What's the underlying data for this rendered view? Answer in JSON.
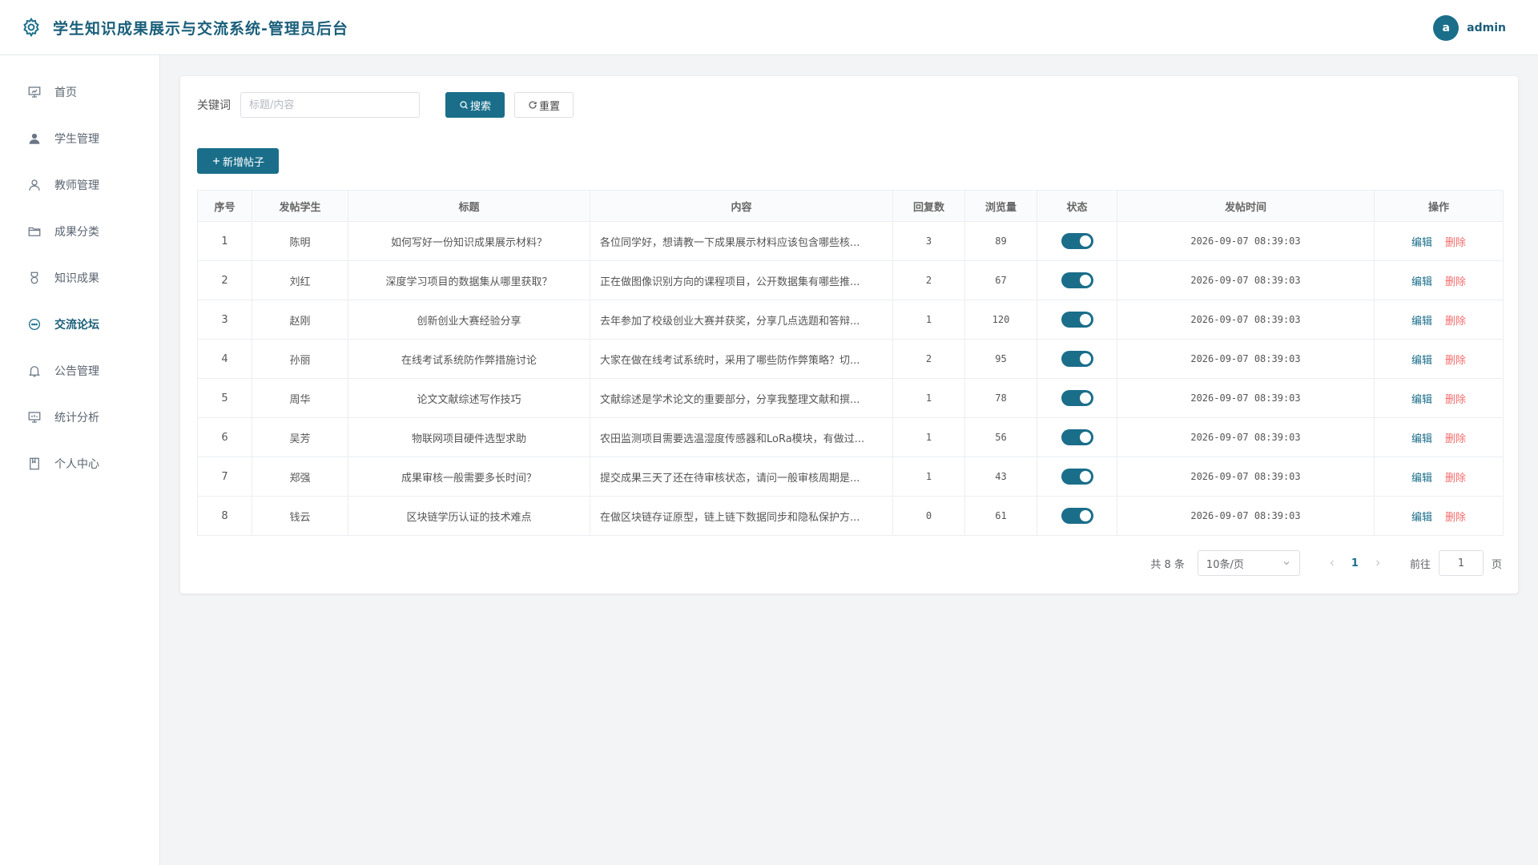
{
  "header": {
    "app_title": "学生知识成果展示与交流系统-管理员后台",
    "avatar_letter": "a",
    "username": "admin",
    "accent_color": "#1a6e8a"
  },
  "sidebar": {
    "items": [
      {
        "label": "首页",
        "icon": "presentation-icon"
      },
      {
        "label": "学生管理",
        "icon": "user-filled-icon"
      },
      {
        "label": "教师管理",
        "icon": "user-outline-icon"
      },
      {
        "label": "成果分类",
        "icon": "folder-icon"
      },
      {
        "label": "知识成果",
        "icon": "medal-icon"
      },
      {
        "label": "交流论坛",
        "icon": "chat-icon"
      },
      {
        "label": "公告管理",
        "icon": "bell-icon"
      },
      {
        "label": "统计分析",
        "icon": "chart-board-icon"
      },
      {
        "label": "个人中心",
        "icon": "notebook-icon"
      }
    ],
    "active": "交流论坛"
  },
  "search": {
    "label": "关键词",
    "placeholder": "标题/内容",
    "search_button": "搜索",
    "reset_button": "重置"
  },
  "toolbar": {
    "add_button": "新增帖子"
  },
  "table": {
    "columns": [
      "序号",
      "发帖学生",
      "标题",
      "内容",
      "回复数",
      "浏览量",
      "状态",
      "发帖时间",
      "操作"
    ],
    "edit_label": "编辑",
    "delete_label": "删除",
    "rows": [
      {
        "no": "1",
        "student": "陈明",
        "title": "如何写好一份知识成果展示材料？",
        "content": "各位同学好，想请教一下成果展示材料应该包含哪些核...",
        "replies": "3",
        "views": "89",
        "status_on": true,
        "time": "2026-09-07 08:39:03"
      },
      {
        "no": "2",
        "student": "刘红",
        "title": "深度学习项目的数据集从哪里获取？",
        "content": "正在做图像识别方向的课程项目，公开数据集有哪些推...",
        "replies": "2",
        "views": "67",
        "status_on": true,
        "time": "2026-09-07 08:39:03"
      },
      {
        "no": "3",
        "student": "赵刚",
        "title": "创新创业大赛经验分享",
        "content": "去年参加了校级创业大赛并获奖，分享几点选题和答辩...",
        "replies": "1",
        "views": "120",
        "status_on": true,
        "time": "2026-09-07 08:39:03"
      },
      {
        "no": "4",
        "student": "孙丽",
        "title": "在线考试系统防作弊措施讨论",
        "content": "大家在做在线考试系统时，采用了哪些防作弊策略？切...",
        "replies": "2",
        "views": "95",
        "status_on": true,
        "time": "2026-09-07 08:39:03"
      },
      {
        "no": "5",
        "student": "周华",
        "title": "论文文献综述写作技巧",
        "content": "文献综述是学术论文的重要部分，分享我整理文献和撰...",
        "replies": "1",
        "views": "78",
        "status_on": true,
        "time": "2026-09-07 08:39:03"
      },
      {
        "no": "6",
        "student": "吴芳",
        "title": "物联网项目硬件选型求助",
        "content": "农田监测项目需要选温湿度传感器和LoRa模块，有做过...",
        "replies": "1",
        "views": "56",
        "status_on": true,
        "time": "2026-09-07 08:39:03"
      },
      {
        "no": "7",
        "student": "郑强",
        "title": "成果审核一般需要多长时间？",
        "content": "提交成果三天了还在待审核状态，请问一般审核周期是...",
        "replies": "1",
        "views": "43",
        "status_on": true,
        "time": "2026-09-07 08:39:03"
      },
      {
        "no": "8",
        "student": "钱云",
        "title": "区块链学历认证的技术难点",
        "content": "在做区块链存证原型，链上链下数据同步和隐私保护方...",
        "replies": "0",
        "views": "61",
        "status_on": true,
        "time": "2026-09-07 08:39:03"
      }
    ]
  },
  "pagination": {
    "total_text": "共 8 条",
    "page_size": "10条/页",
    "current_page": "1",
    "goto_label": "前往",
    "goto_value": "1",
    "page_unit": "页"
  }
}
